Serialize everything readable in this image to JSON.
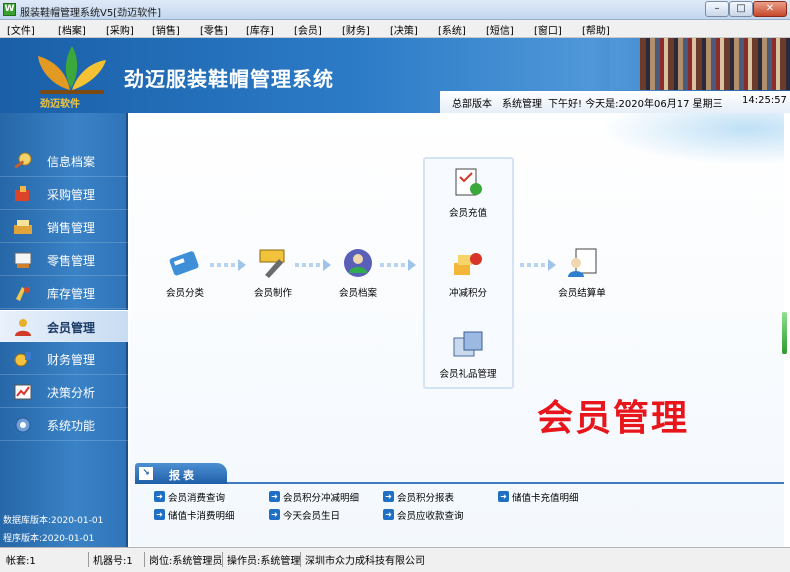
{
  "window": {
    "title": "服装鞋帽管理系统V5[劲迈软件]",
    "icon_text": "W"
  },
  "menu": [
    "[文件]",
    "[档案]",
    "[采购]",
    "[销售]",
    "[零售]",
    "[库存]",
    "[会员]",
    "[财务]",
    "[决策]",
    "[系统]",
    "[短信]",
    "[窗口]",
    "[帮助]"
  ],
  "header": {
    "logo_text": "劲迈软件",
    "app_title": "劲迈服装鞋帽管理系统",
    "version": "总部版本",
    "role": "系统管理",
    "greeting": "下午好! 今天是:2020年06月17 星期三",
    "time": "14:25:57"
  },
  "sidebar": {
    "items": [
      {
        "label": "信息档案",
        "icon": "archive-icon"
      },
      {
        "label": "采购管理",
        "icon": "purchase-icon"
      },
      {
        "label": "销售管理",
        "icon": "sales-icon"
      },
      {
        "label": "零售管理",
        "icon": "retail-icon"
      },
      {
        "label": "库存管理",
        "icon": "inventory-icon"
      },
      {
        "label": "会员管理",
        "icon": "member-icon",
        "active": true
      },
      {
        "label": "财务管理",
        "icon": "finance-icon"
      },
      {
        "label": "决策分析",
        "icon": "analysis-icon"
      },
      {
        "label": "系统功能",
        "icon": "system-icon"
      }
    ],
    "db_version": "数据库版本:2020-01-01",
    "prog_version": "程序版本:2020-01-01"
  },
  "flow": {
    "member_category": "会员分类",
    "card_making": "会员制作",
    "member_archive": "会员档案",
    "recharge": "会员充值",
    "points_offset": "冲减积分",
    "gift_management": "会员礼品管理",
    "settlement": "会员结算单"
  },
  "section_label": "会员管理",
  "reports": {
    "tab_label": "报表",
    "links": [
      [
        "会员消费查询",
        "会员积分冲减明细",
        "会员积分报表",
        "储值卡充值明细"
      ],
      [
        "储值卡消费明细",
        "今天会员生日",
        "会员应收款查询"
      ]
    ]
  },
  "statusbar": {
    "account": "帐套:1",
    "machine": "机器号:1",
    "post": "岗位:系统管理员",
    "operator": "操作员:系统管理",
    "company": "深圳市众力成科技有限公司"
  },
  "colors": {
    "brand_blue": "#2c7bc7",
    "accent_red": "#e8151a",
    "sidebar_blue": "#3a82c6"
  }
}
